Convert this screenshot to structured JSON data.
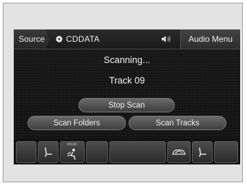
{
  "topbar": {
    "source_label": "Source",
    "source_name": "CDDATA",
    "audio_menu_label": "Audio Menu"
  },
  "main": {
    "status_text": "Scanning...",
    "track_text": "Track 09",
    "stop_scan_label": "Stop Scan",
    "scan_folders_label": "Scan Folders",
    "scan_tracks_label": "Scan Tracks"
  },
  "bottombar": {
    "mode_label": "MODE",
    "icons": [
      "blank-button",
      "seat-heater-driver-icon",
      "air-flow-mode-icon",
      "blank-button",
      "blank-wide-button",
      "recirculation-icon",
      "seat-heater-passenger-icon",
      "blank-button"
    ]
  },
  "colors": {
    "background": "#151515",
    "text": "#f2f2f2",
    "button": "#4f4f4f"
  }
}
